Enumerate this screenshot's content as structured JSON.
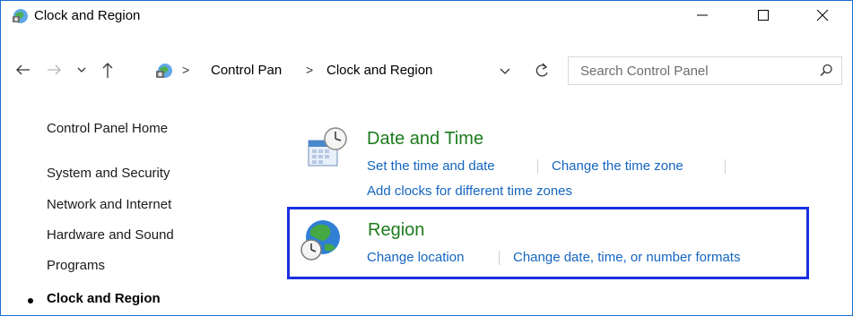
{
  "window": {
    "title": "Clock and Region"
  },
  "address": {
    "crumbs": [
      "Control Pan",
      "Clock and Region"
    ],
    "separator": ">"
  },
  "search": {
    "placeholder": "Search Control Panel"
  },
  "sidebar": {
    "home": "Control Panel Home",
    "items": [
      {
        "label": "System and Security"
      },
      {
        "label": "Network and Internet"
      },
      {
        "label": "Hardware and Sound"
      },
      {
        "label": "Programs"
      },
      {
        "label": "Clock and Region",
        "current": true
      }
    ]
  },
  "categories": [
    {
      "title": "Date and Time",
      "icon": "date-time-icon",
      "tasks": [
        "Set the time and date",
        "Change the time zone",
        "Add clocks for different time zones"
      ]
    },
    {
      "title": "Region",
      "icon": "region-globe-icon",
      "tasks": [
        "Change location",
        "Change date, time, or number formats"
      ]
    }
  ],
  "colors": {
    "accent_border": "#1b6fd1",
    "category_title": "#1e7b1e",
    "link": "#1565c0",
    "highlight": "#1a2fe0"
  }
}
